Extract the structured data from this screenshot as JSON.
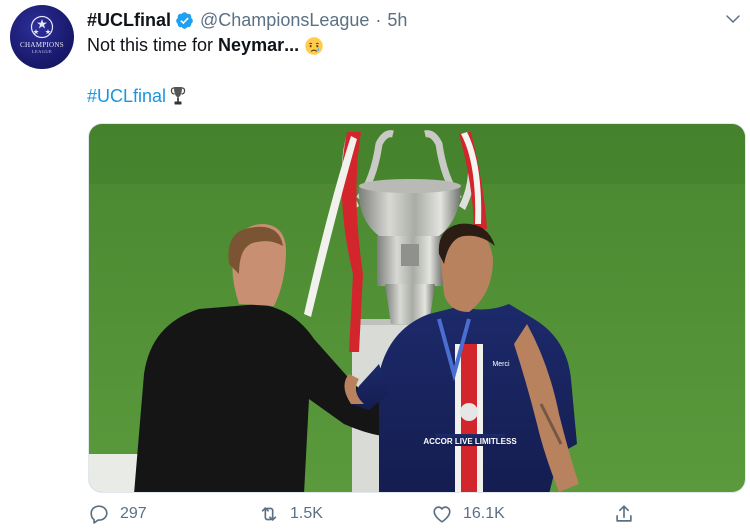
{
  "account": {
    "display_name": "#UCLfinal",
    "handle": "@ChampionsLeague",
    "separator": "·",
    "time": "5h",
    "avatar_text": "CHAMPIONS",
    "avatar_subtext": "LEAGUE",
    "verified_icon": "verified-badge-icon"
  },
  "tweet": {
    "text_prefix": "Not this time for ",
    "text_bold": "Neymar",
    "text_suffix": "...",
    "hashtag": "#UCLfinal",
    "emoji": "crying-face-icon",
    "hashtag_emoji": "trophy-icon"
  },
  "photo": {
    "jersey_sponsor": "ACCOR LIVE LIMITLESS",
    "jersey_brand": "Merci"
  },
  "actions": {
    "reply_count": "297",
    "retweet_count": "1.5K",
    "like_count": "16.1K"
  },
  "colors": {
    "link": "#1b95e0",
    "verified": "#1da1f2",
    "muted": "#5b7083",
    "pitch": "#4f8a33"
  }
}
